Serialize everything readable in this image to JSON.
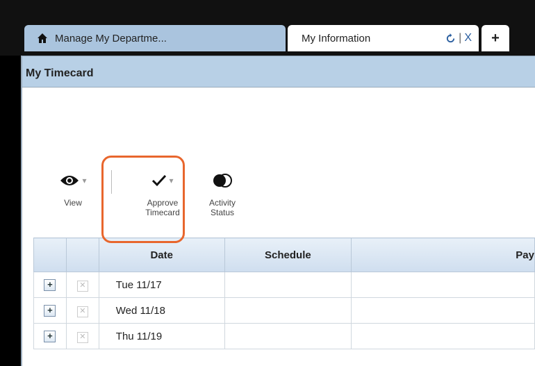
{
  "tabs": {
    "home_label": "Manage My Departme...",
    "info_label": "My Information",
    "info_separator": "|",
    "info_close": "X",
    "add_label": "+"
  },
  "panel": {
    "title": "My Timecard"
  },
  "toolbar": {
    "view_label": "View",
    "approve_label_1": "Approve",
    "approve_label_2": "Timecard",
    "activity_label_1": "Activity",
    "activity_label_2": "Status"
  },
  "grid": {
    "headers": [
      "",
      "",
      "Date",
      "Schedule",
      "Pay"
    ],
    "rows": [
      {
        "date": "Tue 11/17"
      },
      {
        "date": "Wed 11/18"
      },
      {
        "date": "Thu 11/19"
      }
    ]
  },
  "colors": {
    "highlight": "#e8662d",
    "header_bg": "#b8d0e6"
  }
}
